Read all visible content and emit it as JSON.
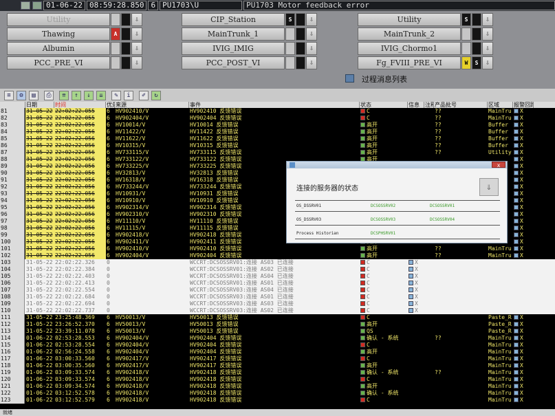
{
  "topstrip": {
    "date": "01-06-22",
    "time": "08:59:28.850",
    "priority": "6",
    "source": "PU1703\\U",
    "message": "PU1703 Motor feedback error"
  },
  "nav": {
    "rows": [
      [
        {
          "label": "Utility",
          "dim": true,
          "boxes": [
            "",
            ""
          ],
          "arrow": "⇩"
        },
        {
          "label": "CIP_Station",
          "boxes": [
            "S",
            ""
          ],
          "arrow": "⇩"
        },
        {
          "label": "Utility",
          "boxes": [
            "S",
            ""
          ],
          "arrow": "⇩"
        }
      ],
      [
        {
          "label": "Thawing",
          "boxes": [
            "A",
            ""
          ],
          "arrow": "⇩"
        },
        {
          "label": "MainTrunk_1",
          "boxes": [
            "",
            ""
          ],
          "arrow": "⇩"
        },
        {
          "label": "MainTrunk_2",
          "boxes": [
            "",
            ""
          ],
          "arrow": "⇩"
        }
      ],
      [
        {
          "label": "Albumin",
          "boxes": [
            "",
            ""
          ],
          "arrow": "⇩"
        },
        {
          "label": "IVIG_IMIG",
          "boxes": [
            "",
            ""
          ],
          "arrow": "⇩"
        },
        {
          "label": "IVIG_Chormo1",
          "boxes": [
            "",
            ""
          ],
          "arrow": "⇩"
        }
      ],
      [
        {
          "label": "PCC_PRE_VI",
          "boxes": [
            "",
            ""
          ],
          "arrow": "⇩"
        },
        {
          "label": "PCC_POST_VI",
          "boxes": [
            "",
            ""
          ],
          "arrow": "⇩"
        },
        {
          "label": "Fg_FVIII_PRE_VI",
          "boxes": [
            "W",
            "S"
          ],
          "arrow": "⇩"
        }
      ]
    ]
  },
  "view": {
    "title": "过程消息列表"
  },
  "table": {
    "headers": [
      "日期",
      "时间",
      "优先级",
      "来源",
      "事件",
      "状态",
      "信息",
      "注释",
      "产品批号",
      "区域",
      "报警回路"
    ],
    "rows": [
      {
        "n": "81",
        "d": "31-05-22",
        "t": "22:02:22.055",
        "p": "6",
        "s": "HV902410/V",
        "e": "HV902410  反馈错误",
        "st": "C",
        "si": "red",
        "info": "",
        "b": "??",
        "a": "MainTru",
        "type": "hl"
      },
      {
        "n": "82",
        "d": "31-05-22",
        "t": "22:02:22.055",
        "p": "6",
        "s": "HV902404/V",
        "e": "HV902404  反馈错误",
        "st": "C",
        "si": "red",
        "info": "",
        "b": "??",
        "a": "MainTru",
        "type": "hl"
      },
      {
        "n": "83",
        "d": "31-05-22",
        "t": "22:02:22.056",
        "p": "6",
        "s": "HV10014/V",
        "e": "HV10014  反馈错误",
        "st": "高开",
        "si": "green",
        "info": "",
        "b": "??",
        "a": "Buffer",
        "type": "hl"
      },
      {
        "n": "84",
        "d": "31-05-22",
        "t": "22:02:22.056",
        "p": "6",
        "s": "HV11422/V",
        "e": "HV11422  反馈错误",
        "st": "高开",
        "si": "green",
        "info": "",
        "b": "??",
        "a": "Buffer",
        "type": "hl"
      },
      {
        "n": "85",
        "d": "31-05-22",
        "t": "22:02:22.056",
        "p": "6",
        "s": "HV11622/V",
        "e": "HV11622  反馈错误",
        "st": "高开",
        "si": "green",
        "info": "",
        "b": "??",
        "a": "Buffer",
        "type": "hl"
      },
      {
        "n": "86",
        "d": "31-05-22",
        "t": "22:02:22.056",
        "p": "6",
        "s": "HV10315/V",
        "e": "HV10315  反馈错误",
        "st": "高开",
        "si": "green",
        "info": "",
        "b": "??",
        "a": "Buffer",
        "type": "hl"
      },
      {
        "n": "87",
        "d": "31-05-22",
        "t": "22:02:22.056",
        "p": "6",
        "s": "HV733115/V",
        "e": "HV733115  反馈错误",
        "st": "高开",
        "si": "green",
        "info": "",
        "b": "??",
        "a": "Utility",
        "type": "hl"
      },
      {
        "n": "88",
        "d": "31-05-22",
        "t": "22:02:22.056",
        "p": "6",
        "s": "HV733122/V",
        "e": "HV733122  反馈错误",
        "st": "高开",
        "si": "green",
        "info": "",
        "b": "",
        "a": "",
        "type": "hl"
      },
      {
        "n": "89",
        "d": "31-05-22",
        "t": "22:02:22.056",
        "p": "6",
        "s": "HV733225/V",
        "e": "HV733225  反馈错误",
        "st": "高开",
        "si": "green",
        "info": "",
        "b": "",
        "a": "",
        "type": "hl"
      },
      {
        "n": "90",
        "d": "31-05-22",
        "t": "22:02:22.056",
        "p": "6",
        "s": "HV32813/V",
        "e": "HV32813  反馈错误",
        "st": "高开",
        "si": "green",
        "info": "",
        "b": "",
        "a": "",
        "type": "hl"
      },
      {
        "n": "91",
        "d": "31-05-22",
        "t": "22:02:22.056",
        "p": "6",
        "s": "HV16318/V",
        "e": "HV16318  反馈错误",
        "st": "高开",
        "si": "green",
        "info": "",
        "b": "",
        "a": "",
        "type": "hl"
      },
      {
        "n": "92",
        "d": "31-05-22",
        "t": "22:02:22.056",
        "p": "6",
        "s": "HV733244/V",
        "e": "HV733244  反馈错误",
        "st": "高开",
        "si": "green",
        "info": "",
        "b": "",
        "a": "",
        "type": "hl"
      },
      {
        "n": "93",
        "d": "31-05-22",
        "t": "22:02:22.056",
        "p": "6",
        "s": "HV10931/V",
        "e": "HV10931  反馈错误",
        "st": "高开",
        "si": "green",
        "info": "",
        "b": "",
        "a": "",
        "type": "hl"
      },
      {
        "n": "94",
        "d": "31-05-22",
        "t": "22:02:22.056",
        "p": "6",
        "s": "HV10910/V",
        "e": "HV10910  反馈错误",
        "st": "高开",
        "si": "green",
        "info": "",
        "b": "",
        "a": "",
        "type": "hl"
      },
      {
        "n": "95",
        "d": "31-05-22",
        "t": "22:02:22.056",
        "p": "6",
        "s": "HV902314/V",
        "e": "HV902314  反馈错误",
        "st": "高开",
        "si": "green",
        "info": "",
        "b": "",
        "a": "",
        "type": "hl"
      },
      {
        "n": "96",
        "d": "31-05-22",
        "t": "22:02:22.056",
        "p": "6",
        "s": "HV902310/V",
        "e": "HV902310  反馈错误",
        "st": "高开",
        "si": "green",
        "info": "",
        "b": "",
        "a": "",
        "type": "hl"
      },
      {
        "n": "97",
        "d": "31-05-22",
        "t": "22:02:22.056",
        "p": "6",
        "s": "HV11110/V",
        "e": "HV11110  反馈错误",
        "st": "高开",
        "si": "green",
        "info": "",
        "b": "",
        "a": "",
        "type": "hl"
      },
      {
        "n": "98",
        "d": "31-05-22",
        "t": "22:02:22.056",
        "p": "6",
        "s": "HV11115/V",
        "e": "HV11115  反馈错误",
        "st": "高开",
        "si": "green",
        "info": "",
        "b": "",
        "a": "",
        "type": "hl"
      },
      {
        "n": "99",
        "d": "31-05-22",
        "t": "22:02:22.056",
        "p": "6",
        "s": "HV902418/V",
        "e": "HV902418  反馈错误",
        "st": "高开",
        "si": "green",
        "info": "",
        "b": "",
        "a": "",
        "type": "hl"
      },
      {
        "n": "100",
        "d": "31-05-22",
        "t": "22:02:22.056",
        "p": "6",
        "s": "HV902411/V",
        "e": "HV902411  反馈错误",
        "st": "高开",
        "si": "green",
        "info": "",
        "b": "",
        "a": "",
        "type": "hl"
      },
      {
        "n": "101",
        "d": "31-05-22",
        "t": "22:02:22.056",
        "p": "6",
        "s": "HV902410/V",
        "e": "HV902410  反馈错误",
        "st": "高开",
        "si": "green",
        "info": "",
        "b": "??",
        "a": "MainTru",
        "type": "hl"
      },
      {
        "n": "102",
        "d": "31-05-22",
        "t": "22:02:22.056",
        "p": "6",
        "s": "HV902404/V",
        "e": "HV902404  反馈错误",
        "st": "高开",
        "si": "green",
        "info": "",
        "b": "??",
        "a": "MainTru",
        "type": "hl"
      },
      {
        "n": "103",
        "d": "31-05-22",
        "t": "22:02:22.326",
        "p": "0",
        "s": "",
        "e": "WCCRT:DCSOSSRV01:连接 AS03 已连接",
        "st": "C",
        "si": "red",
        "info": "X",
        "b": "",
        "a": "",
        "type": "sys"
      },
      {
        "n": "104",
        "d": "31-05-22",
        "t": "22:02:22.384",
        "p": "0",
        "s": "",
        "e": "WCCRT:DCSOSSRV01:连接 AS02 已连接",
        "st": "C",
        "si": "red",
        "info": "X",
        "b": "",
        "a": "",
        "type": "sys"
      },
      {
        "n": "105",
        "d": "31-05-22",
        "t": "22:02:22.403",
        "p": "0",
        "s": "",
        "e": "WCCRT:DCSOSSRV01:连接 AS04 已连接",
        "st": "C",
        "si": "red",
        "info": "X",
        "b": "",
        "a": "",
        "type": "sys"
      },
      {
        "n": "106",
        "d": "31-05-22",
        "t": "22:02:22.413",
        "p": "0",
        "s": "",
        "e": "WCCRT:DCSOSSRV01:连接 AS01 已连接",
        "st": "C",
        "si": "red",
        "info": "X",
        "b": "",
        "a": "",
        "type": "sys"
      },
      {
        "n": "107",
        "d": "31-05-22",
        "t": "22:02:22.554",
        "p": "0",
        "s": "",
        "e": "WCCRT:DCSOSSRV03:连接 AS04 已连接",
        "st": "C",
        "si": "red",
        "info": "X",
        "b": "",
        "a": "",
        "type": "sys"
      },
      {
        "n": "108",
        "d": "31-05-22",
        "t": "22:02:22.684",
        "p": "0",
        "s": "",
        "e": "WCCRT:DCSOSSRV03:连接 AS01 已连接",
        "st": "C",
        "si": "red",
        "info": "X",
        "b": "",
        "a": "",
        "type": "sys"
      },
      {
        "n": "109",
        "d": "31-05-22",
        "t": "22:02:22.694",
        "p": "0",
        "s": "",
        "e": "WCCRT:DCSOSSRV03:连接 AS03 已连接",
        "st": "C",
        "si": "red",
        "info": "X",
        "b": "",
        "a": "",
        "type": "sys"
      },
      {
        "n": "110",
        "d": "31-05-22",
        "t": "22:02:22.737",
        "p": "0",
        "s": "",
        "e": "WCCRT:DCSOSSRV03:连接 AS02 已连接",
        "st": "C",
        "si": "red",
        "info": "X",
        "b": "",
        "a": "",
        "type": "sys"
      },
      {
        "n": "111",
        "d": "31-05-22",
        "t": "23:25:48.369",
        "p": "6",
        "s": "HV50013/V",
        "e": "HV50013  反馈错误",
        "st": "C",
        "si": "red",
        "info": "",
        "b": "",
        "a": "Paste_R",
        "type": "plain"
      },
      {
        "n": "112",
        "d": "31-05-22",
        "t": "23:26:52.370",
        "p": "6",
        "s": "HV50013/V",
        "e": "HV50013  反馈错误",
        "st": "高开",
        "si": "green",
        "info": "",
        "b": "",
        "a": "Paste_R",
        "type": "plain"
      },
      {
        "n": "113",
        "d": "31-05-22",
        "t": "23:39:11.078",
        "p": "6",
        "s": "HV50013/V",
        "e": "HV50013  反馈错误",
        "st": "QS",
        "si": "green",
        "info": "",
        "b": "",
        "a": "Paste_R",
        "type": "plain"
      },
      {
        "n": "114",
        "d": "01-06-22",
        "t": "02:53:28.553",
        "p": "6",
        "s": "HV902404/V",
        "e": "HV902404  反馈错误",
        "st": "确认 - 系统",
        "si": "green",
        "info": "",
        "b": "??",
        "a": "MainTru",
        "type": "plain"
      },
      {
        "n": "115",
        "d": "01-06-22",
        "t": "02:53:28.554",
        "p": "6",
        "s": "HV902404/V",
        "e": "HV902404  反馈错误",
        "st": "C",
        "si": "red",
        "info": "",
        "b": "",
        "a": "MainTru",
        "type": "plain"
      },
      {
        "n": "116",
        "d": "01-06-22",
        "t": "02:56:24.558",
        "p": "6",
        "s": "HV902404/V",
        "e": "HV902404  反馈错误",
        "st": "高开",
        "si": "green",
        "info": "",
        "b": "",
        "a": "MainTru",
        "type": "plain"
      },
      {
        "n": "117",
        "d": "01-06-22",
        "t": "03:00:33.560",
        "p": "6",
        "s": "HV902417/V",
        "e": "HV902417  反馈错误",
        "st": "C",
        "si": "red",
        "info": "",
        "b": "",
        "a": "MainTru",
        "type": "plain"
      },
      {
        "n": "118",
        "d": "01-06-22",
        "t": "03:00:35.560",
        "p": "6",
        "s": "HV902417/V",
        "e": "HV902417  反馈错误",
        "st": "高开",
        "si": "green",
        "info": "",
        "b": "",
        "a": "MainTru",
        "type": "plain"
      },
      {
        "n": "119",
        "d": "01-06-22",
        "t": "03:09:33.574",
        "p": "6",
        "s": "HV902418/V",
        "e": "HV902418  反馈错误",
        "st": "确认 - 系统",
        "si": "green",
        "info": "",
        "b": "??",
        "a": "MainTru",
        "type": "plain"
      },
      {
        "n": "120",
        "d": "01-06-22",
        "t": "03:09:33.574",
        "p": "6",
        "s": "HV902418/V",
        "e": "HV902418  反馈错误",
        "st": "C",
        "si": "red",
        "info": "",
        "b": "",
        "a": "MainTru",
        "type": "plain"
      },
      {
        "n": "121",
        "d": "01-06-22",
        "t": "03:09:34.574",
        "p": "6",
        "s": "HV902418/V",
        "e": "HV902418  反馈错误",
        "st": "高开",
        "si": "green",
        "info": "",
        "b": "",
        "a": "MainTru",
        "type": "plain"
      },
      {
        "n": "122",
        "d": "01-06-22",
        "t": "03:12:52.578",
        "p": "6",
        "s": "HV902418/V",
        "e": "HV902418  反馈错误",
        "st": "确认 - 系统",
        "si": "green",
        "info": "",
        "b": "",
        "a": "MainTru",
        "type": "plain"
      },
      {
        "n": "123",
        "d": "01-06-22",
        "t": "03:12:52.579",
        "p": "6",
        "s": "HV902418/V",
        "e": "HV902418  反馈错误",
        "st": "C",
        "si": "red",
        "info": "",
        "b": "",
        "a": "MainTru",
        "type": "plain"
      }
    ]
  },
  "dialog": {
    "title": "连接的服务器的状态",
    "close": "x",
    "servers": [
      {
        "name": "OS_DSSRV01",
        "a": "DCSOSSRV02",
        "b": "DCSOSSRV01"
      },
      {
        "name": "OS_DSSRV03",
        "a": "DCSOSSRV03",
        "b": "DCSOSSRV04"
      },
      {
        "name": "Process Historian",
        "a": "DCSPHSRV01",
        "b": ""
      }
    ]
  },
  "status": {
    "text": "就绪"
  },
  "colors": {
    "alarm_yellow": "#f2e86a",
    "alarm_red": "#d12a22",
    "ok_green": "#67b34c"
  }
}
